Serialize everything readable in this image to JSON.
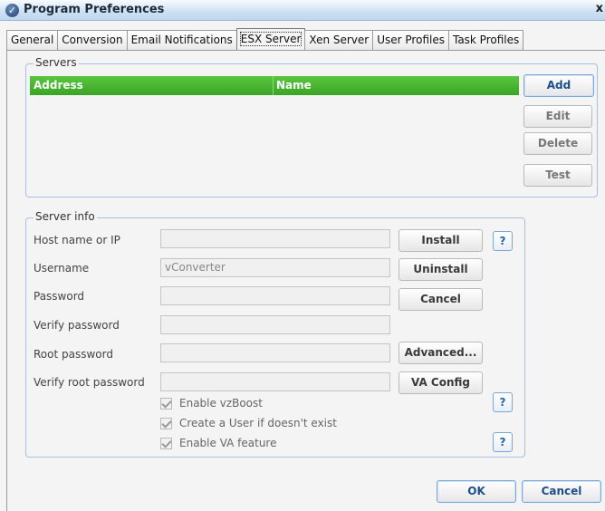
{
  "window": {
    "title": "Program Preferences",
    "close_glyph": "x",
    "icon": "app-logo-icon"
  },
  "tabs": [
    {
      "label": "General"
    },
    {
      "label": "Conversion"
    },
    {
      "label": "Email Notifications"
    },
    {
      "label": "ESX Server",
      "active": true
    },
    {
      "label": "Xen Server"
    },
    {
      "label": "User Profiles"
    },
    {
      "label": "Task Profiles"
    }
  ],
  "servers": {
    "group_title": "Servers",
    "columns": [
      "Address",
      "Name"
    ],
    "buttons": {
      "add": "Add",
      "edit": "Edit",
      "delete": "Delete",
      "test": "Test"
    }
  },
  "server_info": {
    "group_title": "Server info",
    "labels": {
      "host": "Host name or IP",
      "username": "Username",
      "password": "Password",
      "verify_password": "Verify password",
      "root_password": "Root password",
      "verify_root_password": "Verify root password"
    },
    "values": {
      "host": "",
      "username": "vConverter",
      "password": "",
      "verify_password": "",
      "root_password": "",
      "verify_root_password": ""
    },
    "buttons": {
      "install": "Install",
      "uninstall": "Uninstall",
      "cancel": "Cancel",
      "advanced": "Advanced...",
      "va_config": "VA Config"
    },
    "help_glyph": "?",
    "checkboxes": {
      "vzboost": "Enable vzBoost",
      "create_user": "Create a User if doesn't exist",
      "va_feature": "Enable VA feature"
    }
  },
  "footer": {
    "ok": "OK",
    "cancel": "Cancel"
  },
  "colors": {
    "accent_green": "#3aa424",
    "title_blue": "#cfe2f5",
    "button_blue": "#1d4e8a"
  }
}
